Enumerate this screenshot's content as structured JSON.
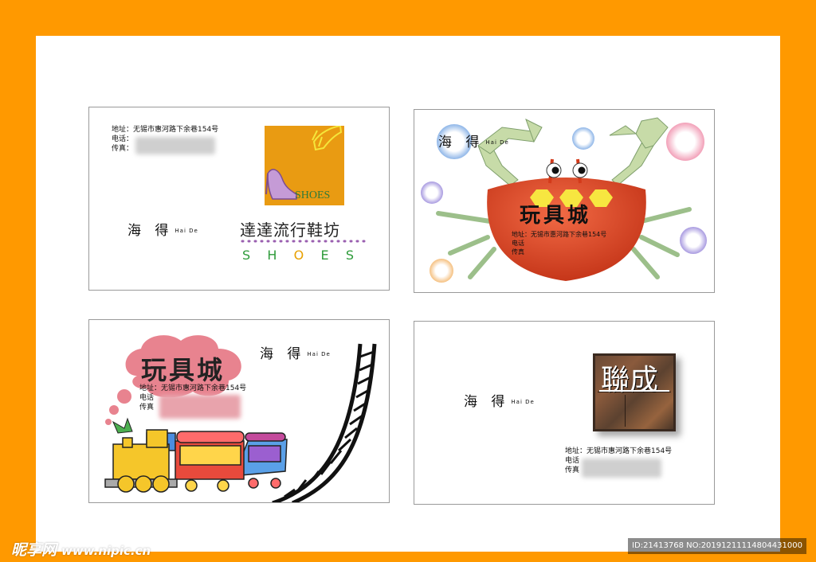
{
  "colors": {
    "frame": "#ff9900",
    "sheet": "#ffffff",
    "crab": "#e8482a",
    "cloud": "#e8838f",
    "shoe_box": "#e99b12"
  },
  "card1": {
    "address": "地址：无锡市惠河路下余巷154号",
    "phone_label": "电话：",
    "fax_label": "传真：",
    "brand": "海 得",
    "brand_pinyin": "Hai De",
    "logo_text": "SHOES",
    "store_name": "達達流行鞋坊",
    "shoes_letters": [
      "S",
      "H",
      "O",
      "E",
      "S"
    ]
  },
  "card2": {
    "brand": "海 得",
    "brand_pinyin": "Hai De",
    "title": "玩具城",
    "address": "地址：无锡市惠河路下余巷154号",
    "phone_label": "电话",
    "fax_label": "传真"
  },
  "card3": {
    "title": "玩具城",
    "brand": "海 得",
    "brand_pinyin": "Hai De",
    "address": "地址：无锡市惠河路下余巷154号",
    "phone_label": "电话",
    "fax_label": "传真"
  },
  "card4": {
    "brand": "海 得",
    "brand_pinyin": "Hai De",
    "logo_text": "聯成",
    "address": "地址：无锡市惠河路下余巷154号",
    "phone_label": "电话",
    "fax_label": "传真"
  },
  "watermark": {
    "site_logo": "昵享网",
    "site_url": "www.nipic.cn",
    "id_text": "ID:21413768 NO:20191211114804431000"
  }
}
